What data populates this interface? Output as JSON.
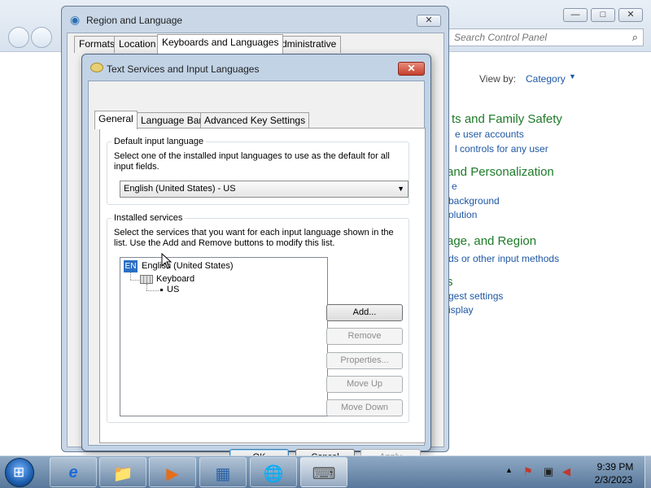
{
  "control_panel": {
    "search_placeholder": "Search Control Panel",
    "view_by_label": "View by:",
    "view_by_value": "Category",
    "sections": [
      {
        "heading": "ts and Family Safety",
        "links": [
          "e user accounts",
          "l controls for any user"
        ]
      },
      {
        "heading": "and Personalization",
        "links": [
          "e",
          "background",
          "olution"
        ]
      },
      {
        "heading": "age, and Region",
        "links": [
          "ds or other input methods"
        ]
      },
      {
        "heading": "s",
        "links": [
          "gest settings",
          "isplay"
        ]
      }
    ]
  },
  "region_dialog": {
    "title": "Region and Language",
    "tabs": [
      "Formats",
      "Location",
      "Keyboards and Languages",
      "Administrative"
    ],
    "active_tab": "Keyboards and Languages",
    "close_glyph": "✕"
  },
  "text_services_dialog": {
    "title": "Text Services and Input Languages",
    "close_glyph": "✕",
    "tabs": [
      "General",
      "Language Bar",
      "Advanced Key Settings"
    ],
    "active_tab": "General",
    "default_language": {
      "legend": "Default input language",
      "description": "Select one of the installed input languages to use as the default for all input fields.",
      "selected": "English (United States) - US"
    },
    "installed_services": {
      "legend": "Installed services",
      "description": "Select the services that you want for each input language shown in the list. Use the Add and Remove buttons to modify this list.",
      "tree": {
        "language_badge": "EN",
        "language": "English (United States)",
        "category": "Keyboard",
        "item": "US"
      },
      "buttons": {
        "add": "Add...",
        "remove": "Remove",
        "properties": "Properties...",
        "move_up": "Move Up",
        "move_down": "Move Down"
      }
    },
    "footer": {
      "ok": "OK",
      "cancel": "Cancel",
      "apply": "Apply"
    }
  },
  "taskbar": {
    "time": "9:39 PM",
    "date": "2/3/2023",
    "apps": [
      {
        "icon": "internet-explorer-icon",
        "glyph": "e"
      },
      {
        "icon": "file-explorer-icon",
        "glyph": "📁"
      },
      {
        "icon": "media-player-icon",
        "glyph": "▶"
      },
      {
        "icon": "control-panel-icon",
        "glyph": "▦"
      },
      {
        "icon": "region-globe-icon",
        "glyph": "🌐"
      },
      {
        "icon": "text-services-icon",
        "glyph": "⌨"
      }
    ]
  }
}
